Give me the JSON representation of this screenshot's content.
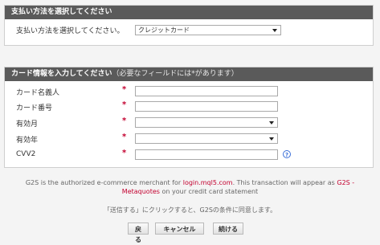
{
  "payment_method_panel": {
    "title": "支払い方法を選択してください",
    "label": "支払い方法を選択してください。",
    "selected": "クレジットカード"
  },
  "card_panel": {
    "title": "カード情報を入力してください",
    "note": "（必要なフィールドには*があります）",
    "required_marker": "*",
    "fields": {
      "cardholder": {
        "label": "カード名義人",
        "value": ""
      },
      "card_number": {
        "label": "カード番号",
        "value": ""
      },
      "exp_month": {
        "label": "有効月",
        "value": ""
      },
      "exp_year": {
        "label": "有効年",
        "value": ""
      },
      "cvv2": {
        "label": "CVV2",
        "value": ""
      }
    },
    "help_glyph": "?"
  },
  "merchant_info": {
    "text_before": "G2S is the authorized e-commerce merchant for ",
    "site_link": "login.mql5.com",
    "text_middle": ". This transaction will appear as ",
    "statement_name": "G2S - Metaquotes",
    "text_after": " on your credit card statement"
  },
  "consent_text": "「送信する」にクリックすると、G2Sの条件に同意します。",
  "buttons": {
    "back": "戻る",
    "cancel": "キャンセル",
    "continue": "続ける"
  },
  "colors": {
    "header_bg": "#5a5a5a",
    "required": "#c3002f",
    "link": "#c3002f",
    "help_icon": "#3a6fd8"
  }
}
